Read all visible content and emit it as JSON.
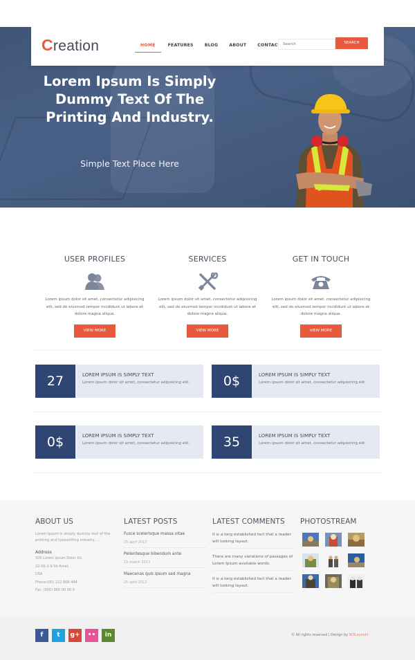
{
  "header": {
    "logo_initial": "C",
    "logo_rest": "reation",
    "nav": [
      {
        "label": "HOME",
        "active": true
      },
      {
        "label": "FEATURES",
        "active": false
      },
      {
        "label": "BLOG",
        "active": false
      },
      {
        "label": "ABOUT",
        "active": false
      },
      {
        "label": "CONTACT",
        "active": false
      }
    ],
    "search_placeholder": "Search",
    "search_button": "SEARCH"
  },
  "hero": {
    "title": "Lorem Ipsum Is Simply Dummy Text Of The Printing And Industry.",
    "subtitle": "Simple Text Place Here"
  },
  "features": [
    {
      "title": "USER PROFILES",
      "icon": "users-icon",
      "text": "Lorem ipsum dolor sit amet, consectetur adipisicing elit, sed do eiusmod tempor incididunt ut labore et dolore magna aliqua.",
      "button": "VIEW MORE"
    },
    {
      "title": "SERVICES",
      "icon": "tools-icon",
      "text": "Lorem ipsum dolor sit amet, consectetur adipisicing elit, sed do eiusmod tempor incididunt ut labore et dolore magna aliqua.",
      "button": "VIEW MORE"
    },
    {
      "title": "GET IN TOUCH",
      "icon": "phone-icon",
      "text": "Lorem ipsum dolor sit amet, consectetur adipisicing elit, sed do eiusmod tempor incididunt ut labore et dolore magna aliqua.",
      "button": "VIEW MORE"
    }
  ],
  "stats": [
    {
      "value": "27",
      "title": "LOREM IPSUM IS SIMPLY TEXT",
      "text": "Lorem ipsum dolor sit amet, consectetur adipisicing elit."
    },
    {
      "value": "0$",
      "title": "LOREM IPSUM IS SIMPLY TEXT",
      "text": "Lorem ipsum dolor sit amet, consectetur adipisicing elit."
    },
    {
      "value": "0$",
      "title": "LOREM IPSUM IS SIMPLY TEXT",
      "text": "Lorem ipsum dolor sit amet, consectetur adipisicing elit."
    },
    {
      "value": "35",
      "title": "LOREM IPSUM IS SIMPLY TEXT",
      "text": "Lorem ipsum dolor sit amet, consectetur adipisicing elit."
    }
  ],
  "footer": {
    "about": {
      "heading": "ABOUT US",
      "text": "Lorem Ipsum is simply dummy text of the printing and typesetting industry. ....",
      "address_heading": "Address",
      "address_lines": [
        "500 Lorem Ipsum Dolor Sit,",
        "22-56-2-9 Sit Amet,",
        "USA",
        "Phone:(00) 222 666 444",
        "Fax: (000) 000 00 00 0"
      ]
    },
    "posts": {
      "heading": "LATEST POSTS",
      "items": [
        {
          "title": "Fusce scelerisque massa vitae",
          "date": "25 april 2013"
        },
        {
          "title": "Pellentesque bibendum ante",
          "date": "15 march 2013"
        },
        {
          "title": "Maecenas quis ipsum sed magna",
          "date": "25 april 2013"
        }
      ]
    },
    "comments": {
      "heading": "LATEST COMMENTS",
      "items": [
        "It is a long established fact that a reader will looking layout.",
        "There are many variations of passages of Lorem Ipsum available words.",
        "It is a long established fact that a reader will looking layout."
      ]
    },
    "photostream": {
      "heading": "PHOTOSTREAM",
      "count": 9
    }
  },
  "bottom": {
    "social": [
      {
        "name": "facebook",
        "glyph": "f",
        "color": "#3b5998"
      },
      {
        "name": "twitter",
        "glyph": "t",
        "color": "#1fa3e0"
      },
      {
        "name": "google-plus",
        "glyph": "g+",
        "color": "#d9473b"
      },
      {
        "name": "flickr",
        "glyph": "••",
        "color": "#e8539a"
      },
      {
        "name": "linkedin",
        "glyph": "in",
        "color": "#5a8a2e"
      }
    ],
    "copyright": "© All rights reserved | Design by",
    "designer": "W3Layouts"
  },
  "colors": {
    "accent": "#e85a3e",
    "navy": "#2f4674",
    "stat_bg": "#e5e9f1"
  }
}
